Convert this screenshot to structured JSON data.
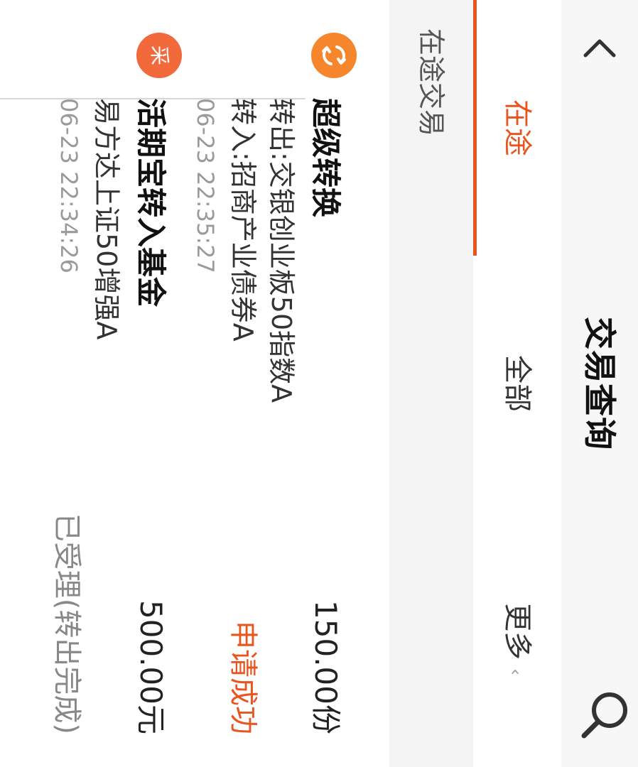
{
  "header": {
    "title": "交易查询",
    "back_icon": "chevron-left-icon",
    "search_icon": "search-icon"
  },
  "tabs": [
    {
      "label": "在途",
      "active": true
    },
    {
      "label": "全部",
      "active": false
    },
    {
      "label": "更多",
      "active": false,
      "chevron": "‹"
    }
  ],
  "section": {
    "label": "在途交易"
  },
  "colors": {
    "accent": "#e8551f",
    "icon1": "#f5862b",
    "icon2": "#f26a3b"
  },
  "transactions": [
    {
      "icon": "swap-icon",
      "title": "超级转换",
      "line1": "转出:交银创业板50指数A",
      "line2": "转入:招商产业债券A",
      "time": "06-23 22:35:27",
      "amount": "150.00份",
      "status": "申请成功"
    },
    {
      "icon": "cai-badge-icon",
      "icon_char": "采",
      "title": "活期宝转入基金",
      "line1": "易方达上证50增强A",
      "time": "06-23 22:34:26",
      "amount": "500.00元",
      "status": "已受理(转出完成)"
    }
  ]
}
